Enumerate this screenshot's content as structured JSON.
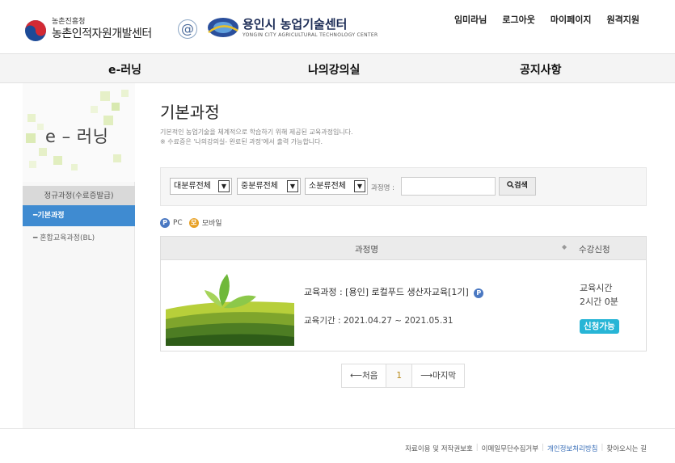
{
  "header": {
    "gov_agency": "농촌진흥청",
    "gov_center": "농촌인적자원개발센터",
    "city_name": "용인시 농업기술센터",
    "city_sub": "YONGIN CITY   AGRICULTURAL TECHNOLOGY CENTER",
    "at_symbol": "@",
    "util_links": [
      "원격지원",
      "마이페이지",
      "로그아웃",
      "임미라님"
    ]
  },
  "gnb": {
    "items": [
      "e-러닝",
      "나의강의실",
      "공지사항"
    ]
  },
  "lnb": {
    "title": "e – 러닝",
    "category": "정규과정(수료증발급)",
    "items": [
      {
        "label": "━기본과정",
        "active": true
      },
      {
        "label": "━ 혼합교육과정(BL)",
        "active": false
      }
    ]
  },
  "main": {
    "title": "기본과정",
    "desc_line1": "기본적인 농업기술을 체계적으로 학습하기 위해 제공된 교육과정입니다.",
    "desc_line2": "※ 수료증은 '나의강의실- 완료된 과정'에서 출력 가능합니다."
  },
  "search": {
    "select_large": "대분류전체",
    "select_medium": "중분류전체",
    "select_small": "소분류전체",
    "course_label": "과정명 :",
    "button_label": "검색"
  },
  "legend": {
    "pc": "PC",
    "mobile": "모바일",
    "pc_badge": "P",
    "mobile_badge": "모"
  },
  "table": {
    "col_name": "과정명",
    "col_sort": "◆",
    "col_apply": "수강신청",
    "rows": [
      {
        "course": "교육과정 : [용인] 로컬푸드 생산자교육[1기]",
        "period": "교육기간 : 2021.04.27 ~ 2021.05.31",
        "time_label": "교육시간",
        "time_value": "2시간 0분",
        "status": "신청가능"
      }
    ]
  },
  "pager": {
    "first": "⟵처음",
    "current": "1",
    "last": "⟶마지막"
  },
  "footer": {
    "links": [
      "자료이용 및 저작권보호",
      "이메일무단수집거부",
      "개인정보처리방침",
      "찾아오시는 길"
    ]
  },
  "colors": {
    "accent": "#3f8bd1",
    "status": "#27b5d6",
    "pc": "#4a78c2",
    "mobile": "#e8a126"
  }
}
